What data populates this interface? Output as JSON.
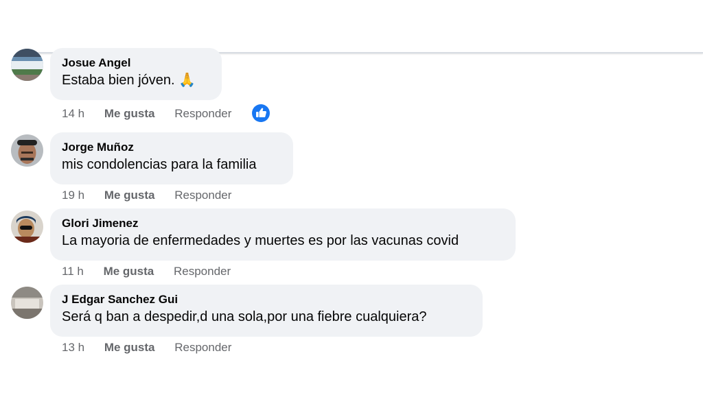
{
  "comments": [
    {
      "author": "Josue Angel",
      "text": "Estaba bien jóven. 🙏",
      "time": "14 h",
      "like_label": "Me gusta",
      "reply_label": "Responder",
      "reaction": "like-icon"
    },
    {
      "author": "Jorge Muñoz",
      "text": "mis condolencias para la familia",
      "time": "19 h",
      "like_label": "Me gusta",
      "reply_label": "Responder"
    },
    {
      "author": "Glori Jimenez",
      "text": "La mayoria de enfermedades y muertes es por las vacunas covid",
      "time": "11 h",
      "like_label": "Me gusta",
      "reply_label": "Responder"
    },
    {
      "author": "J Edgar Sanchez Gui",
      "text": "Será q ban a despedir,d una sola,por una fiebre cualquiera?",
      "time": "13 h",
      "like_label": "Me gusta",
      "reply_label": "Responder"
    }
  ],
  "colors": {
    "bubble_bg": "#f0f2f5",
    "meta_text": "#65676b",
    "like_blue": "#1877f2"
  }
}
